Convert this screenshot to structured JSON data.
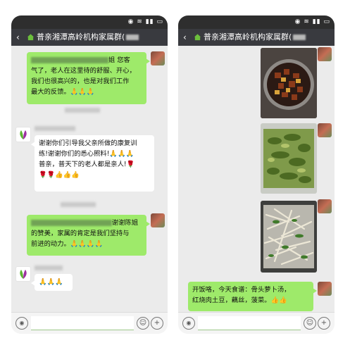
{
  "status_bar": {
    "icons": "◉ ≋ ▮▮ ▭"
  },
  "left_phone": {
    "title": "普亲湘潭高岭机构家属群(",
    "messages": [
      {
        "type": "text",
        "lines": [
          "姐  您客",
          "气了，老人在这里待的舒服、开心，",
          "我们也很高兴的，也是对我们工作",
          "最大的反馈。🙏🙏🙏"
        ]
      },
      {
        "type": "text",
        "lines": [
          "谢谢你们引导我父亲所做的康复训",
          "练!谢谢你们的悉心照料!🙏🙏🙏",
          "普亲，普天下的老人都是亲人!🌹",
          "🌹🌹👍👍👍"
        ]
      },
      {
        "type": "text",
        "lines": [
          "谢谢陈姐",
          "的赞美，家属的肯定是我们坚持与",
          "前进的动力。🙏🙏🙏🙏"
        ]
      },
      {
        "type": "text",
        "lines": [
          "🙏🙏🙏"
        ]
      }
    ]
  },
  "right_phone": {
    "title": "普亲湘潭高岭机构家属群(",
    "messages": [
      {
        "type": "photo",
        "subject": "braised pork with potatoes"
      },
      {
        "type": "photo",
        "subject": "spinach dish"
      },
      {
        "type": "photo",
        "subject": "shredded potatoes with greens"
      },
      {
        "type": "text",
        "lines": [
          "开饭咯，今天食谱：骨头萝卜汤，",
          "红烧肉土豆，藕丝，菠菜。👍👍"
        ]
      }
    ]
  },
  "icons": {
    "back": "‹",
    "house": "house-icon",
    "voice": "◉",
    "emoji": "☺",
    "plus": "+"
  },
  "colors": {
    "status_bar": "#2e2e2e",
    "title_bar": "#393a3f",
    "chat_bg": "#ebebeb",
    "bubble_self": "#9eea6a",
    "bubble_other": "#ffffff"
  }
}
